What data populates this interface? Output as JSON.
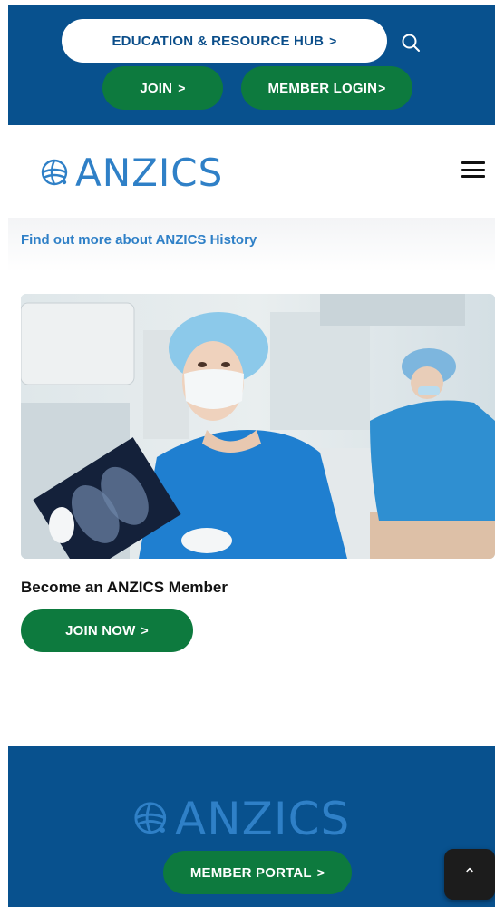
{
  "topbar": {
    "education_label": "EDUCATION & RESOURCE HUB",
    "join_label": "JOIN",
    "login_label": "MEMBER LOGIN",
    "chevron": ">"
  },
  "brand": {
    "logo_text": "ANZICS"
  },
  "history": {
    "link": "Find out more about ANZICS History"
  },
  "member": {
    "heading": "Become an ANZICS Member",
    "join_now_label": "JOIN NOW"
  },
  "footer": {
    "logo_text": "ANZICS",
    "portal_label": "MEMBER PORTAL"
  },
  "back_to_top": {
    "glyph": "⌃"
  },
  "colors": {
    "primary_blue": "#08518e",
    "brand_blue": "#2f80c7",
    "green": "#0d7a3e"
  }
}
